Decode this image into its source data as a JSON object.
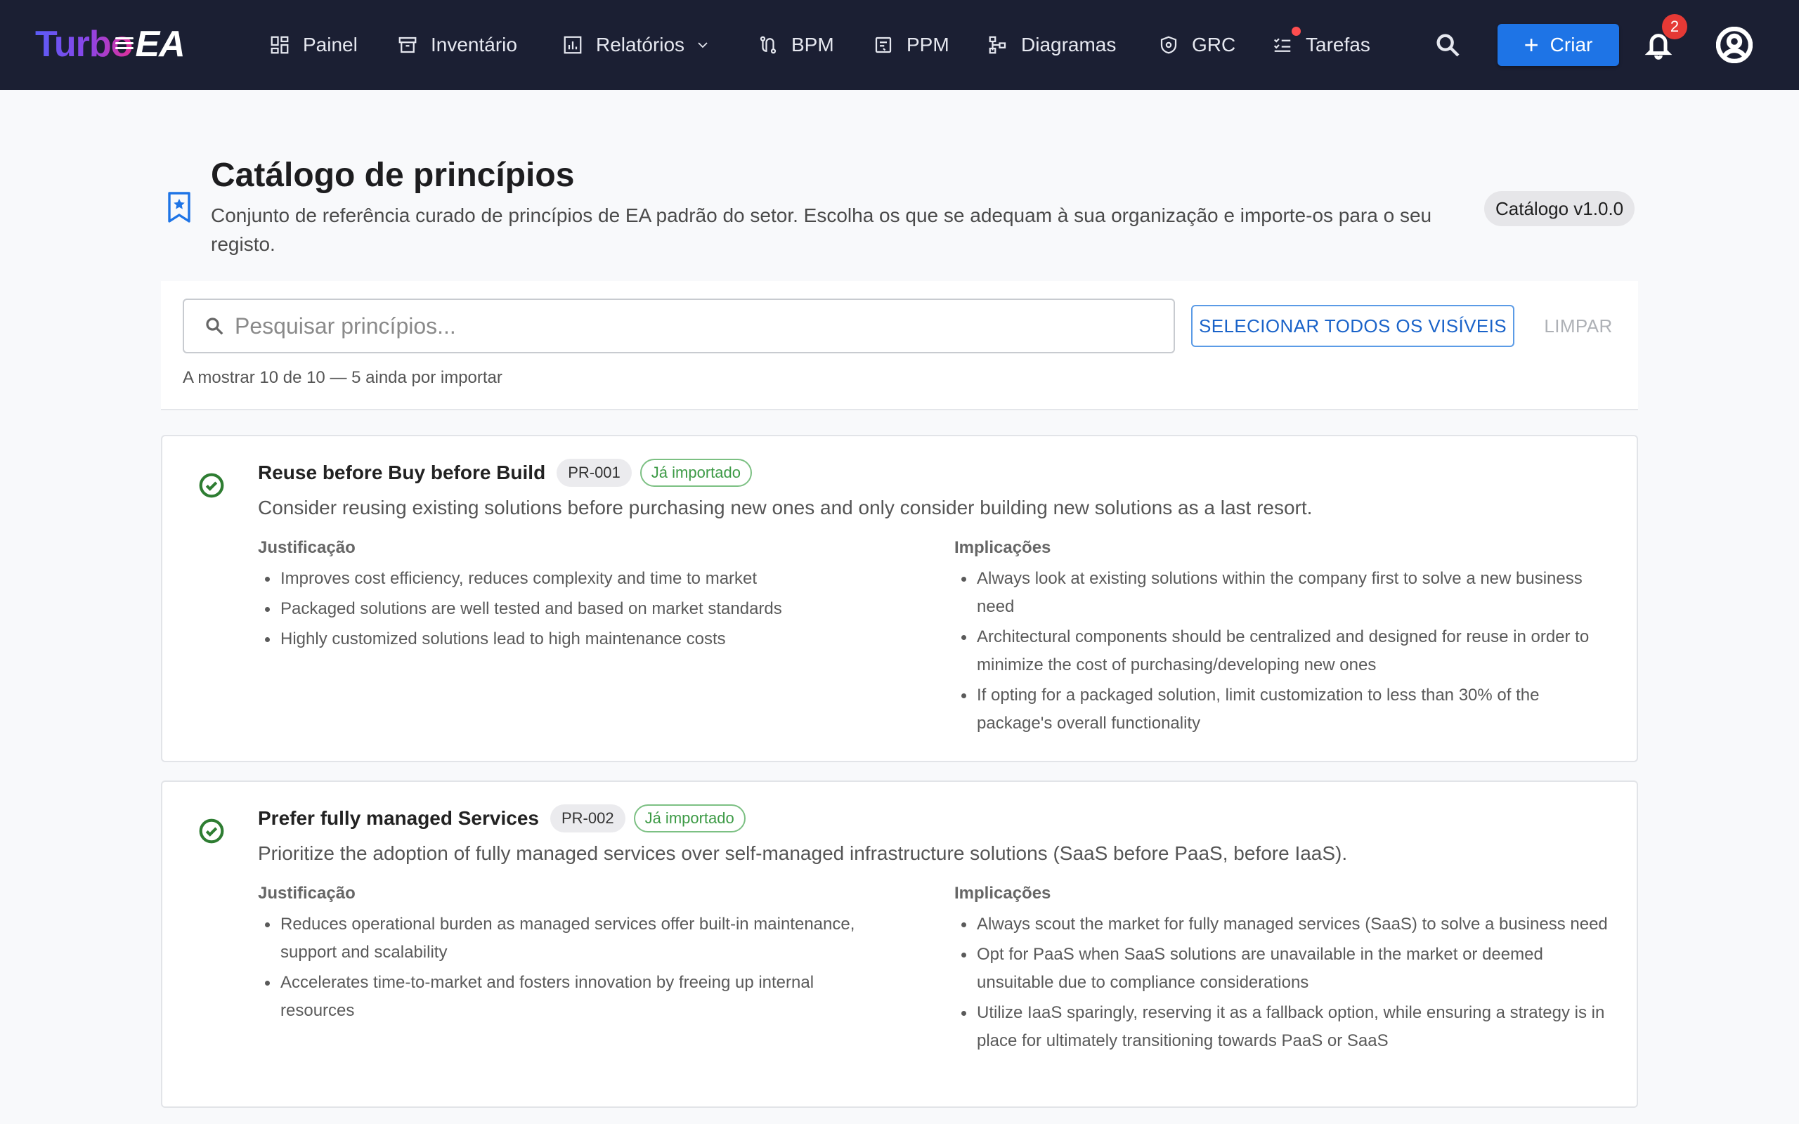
{
  "app": {
    "logo_part1": "Turbo",
    "logo_part2": "EA"
  },
  "nav": {
    "items": [
      {
        "label": "Painel",
        "icon": "dashboard-icon"
      },
      {
        "label": "Inventário",
        "icon": "archive-icon"
      },
      {
        "label": "Relatórios",
        "icon": "bar-chart-icon"
      },
      {
        "label": "BPM",
        "icon": "route-icon"
      },
      {
        "label": "PPM",
        "icon": "project-icon"
      },
      {
        "label": "Diagramas",
        "icon": "diagram-icon"
      },
      {
        "label": "GRC",
        "icon": "shield-icon"
      },
      {
        "label": "Tarefas",
        "icon": "checklist-icon"
      }
    ],
    "create_label": "Criar",
    "notification_count": "2"
  },
  "page": {
    "title": "Catálogo de princípios",
    "subtitle": "Conjunto de referência curado de princípios de EA padrão do setor. Escolha os que se adequam à sua organização e importe-os para o seu registo.",
    "version": "Catálogo v1.0.0"
  },
  "search": {
    "placeholder": "Pesquisar princípios...",
    "value": "",
    "select_all_label": "SELECIONAR TODOS OS VISÍVEIS",
    "clear_label": "LIMPAR",
    "count_text": "A mostrar 10 de 10 — 5 ainda por importar"
  },
  "labels": {
    "rationale": "Justificação",
    "implications": "Implicações"
  },
  "principles": [
    {
      "title": "Reuse before Buy before Build",
      "id": "PR-001",
      "status": "Já importado",
      "description": "Consider reusing existing solutions before purchasing new ones and only consider building new solutions as a last resort.",
      "rationale": [
        "Improves cost efficiency, reduces complexity and time to market",
        "Packaged solutions are well tested and based on market standards",
        "Highly customized solutions lead to high maintenance costs"
      ],
      "implications": [
        "Always look at existing solutions within the company first to solve a new business need",
        "Architectural components should be centralized and designed for reuse in order to minimize the cost of purchasing/developing new ones",
        "If opting for a packaged solution, limit customization to less than 30% of the package's overall functionality"
      ]
    },
    {
      "title": "Prefer fully managed Services",
      "id": "PR-002",
      "status": "Já importado",
      "description": "Prioritize the adoption of fully managed services over self-managed infrastructure solutions (SaaS before PaaS, before IaaS).",
      "rationale": [
        "Reduces operational burden as managed services offer built-in maintenance, support and scalability",
        "Accelerates time-to-market and fosters innovation by freeing up internal resources"
      ],
      "implications": [
        "Always scout the market for fully managed services (SaaS) to solve a business need",
        "Opt for PaaS when SaaS solutions are unavailable in the market or deemed unsuitable due to compliance considerations",
        "Utilize IaaS sparingly, reserving it as a fallback option, while ensuring a strategy is in place for ultimately transitioning towards PaaS or SaaS"
      ]
    }
  ]
}
